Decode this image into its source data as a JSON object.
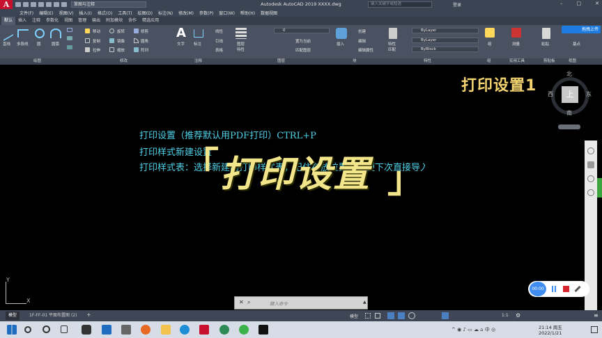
{
  "app": {
    "title": "Autodesk AutoCAD 2019    XXXX.dwg",
    "workspace": "草图与注释",
    "search_placeholder": "键入关键字或短语",
    "login": "登录",
    "logo_letter": "A"
  },
  "menu": [
    "文件(F)",
    "编辑(E)",
    "视图(V)",
    "插入(I)",
    "格式(O)",
    "工具(T)",
    "绘图(D)",
    "标注(N)",
    "修改(M)",
    "参数(P)",
    "窗口(W)",
    "帮助(H)",
    "数据视图"
  ],
  "ribbon_tabs": [
    "默认",
    "插入",
    "注释",
    "参数化",
    "视图",
    "管理",
    "输出",
    "附加模块",
    "协作",
    "精选应用"
  ],
  "ribbon": {
    "draw_tools": [
      "直线",
      "多段线",
      "圆",
      "圆弧"
    ],
    "modify_tools": [
      "移动",
      "旋转",
      "修剪",
      "复制",
      "镜像",
      "圆角",
      "拉伸",
      "缩放",
      "阵列"
    ],
    "annotation_tools": [
      "文字",
      "标注",
      "线性",
      "引线",
      "表格"
    ],
    "layer_tools": [
      "图层特性",
      "置为当前",
      "匹配图层"
    ],
    "layer_value": "0",
    "block_tools": [
      "插入",
      "创建",
      "编辑",
      "编辑属性"
    ],
    "properties": {
      "match": "特性匹配",
      "color": "ByLayer",
      "linetype": "ByLayer",
      "lineweight": "ByBlock"
    },
    "group": "组",
    "utility": "测量",
    "clipboard": "粘贴",
    "base": "基点",
    "upgrade_button": "拖拽上传"
  },
  "panel_labels": [
    "绘图",
    "修改",
    "注释",
    "图层",
    "块",
    "特性",
    "组",
    "实用工具",
    "剪贴板",
    "视图"
  ],
  "canvas": {
    "header": "打印设置1",
    "lines": [
      "打印设置（推荐默认用PDF打印）CTRL+P",
      "打印样式新建设置",
      "打印样式表：选择新建的打印样式表，记住存放位置，方便下次直接导入一样设置"
    ],
    "overlay_title": "打印设置",
    "overlay_left_bracket": "「",
    "overlay_right_bracket": "」"
  },
  "viewcube": {
    "north": "北",
    "south": "南",
    "east": "东",
    "west": "西",
    "top": "上"
  },
  "ucs": {
    "x": "X",
    "y": "Y"
  },
  "command": {
    "placeholder": "键入命令"
  },
  "recorder": {
    "time": "00:00"
  },
  "layouts": [
    "模型",
    "1F-FF-01 平面布置图 (2)"
  ],
  "status": {
    "model": "模型",
    "scale": "1:1"
  },
  "clock": {
    "time": "21:14 周五",
    "date": "2022/1/21"
  },
  "colors": {
    "accent": "#c8102e",
    "drawing_text": "#4fd1e8",
    "overlay_text": "#f3e58a",
    "title_text": "#f3d270"
  }
}
